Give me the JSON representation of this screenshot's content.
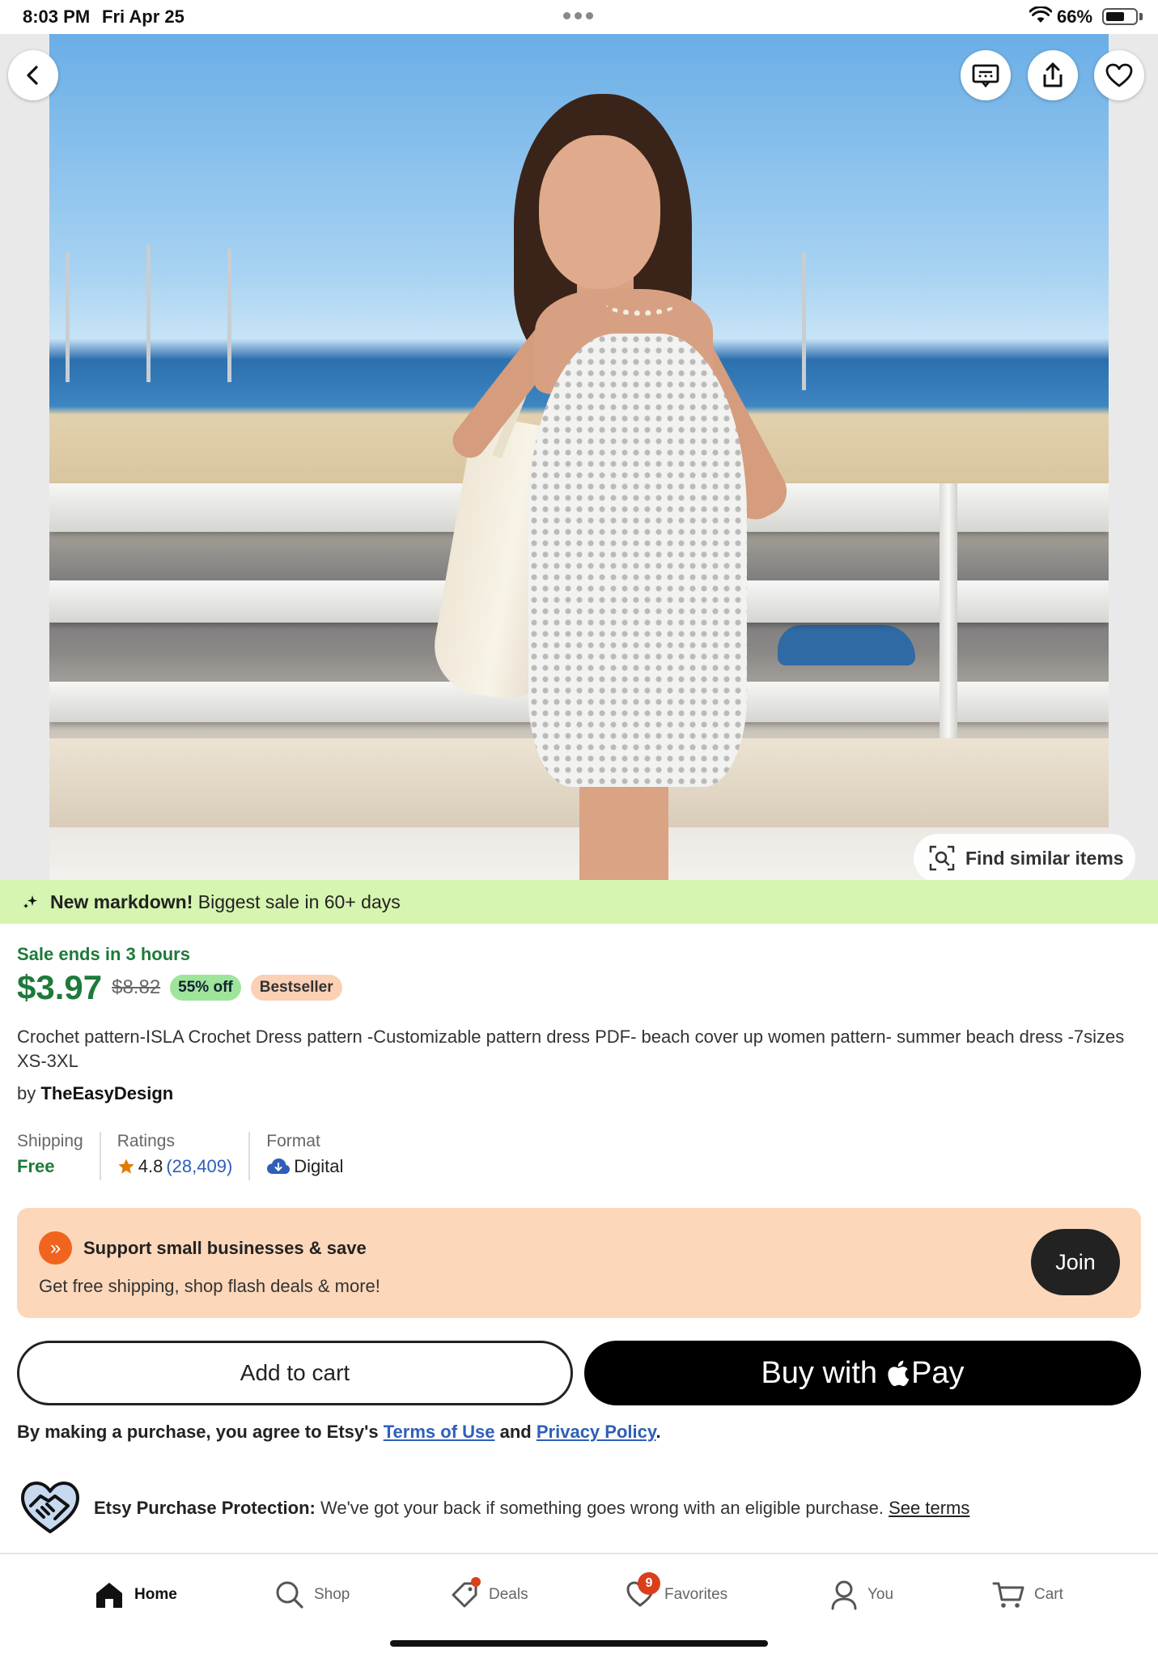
{
  "status_bar": {
    "time": "8:03 PM",
    "date": "Fri Apr 25",
    "battery": "66%",
    "battery_level": 0.66
  },
  "hero": {
    "find_similar_label": "Find similar items",
    "carousel_position": 0.08
  },
  "markdown_banner": {
    "bold": "New markdown!",
    "text": "Biggest sale in 60+ days"
  },
  "pricing": {
    "sale_ends": "Sale ends in 3 hours",
    "price": "$3.97",
    "original_price": "$8.82",
    "discount": "55% off",
    "badge": "Bestseller"
  },
  "listing": {
    "title": "Crochet pattern-ISLA Crochet Dress pattern -Customizable pattern dress PDF- beach cover up women pattern- summer beach dress -7sizes XS-3XL",
    "seller_prefix": "by",
    "seller_name": "TheEasyDesign"
  },
  "stats": {
    "shipping_label": "Shipping",
    "shipping_value": "Free",
    "ratings_label": "Ratings",
    "rating_value": "4.8",
    "rating_count": "(28,409)",
    "format_label": "Format",
    "format_value": "Digital"
  },
  "promo": {
    "title": "Support small businesses & save",
    "subtitle": "Get free shipping, shop flash deals & more!",
    "join_label": "Join"
  },
  "actions": {
    "add_to_cart": "Add to cart",
    "buy_with": "Buy with",
    "pay": "Pay"
  },
  "terms": {
    "prefix": "By making a purchase, you agree to Etsy's",
    "terms_link": "Terms of Use",
    "and": "and",
    "privacy_link": "Privacy Policy",
    "suffix": "."
  },
  "protection": {
    "bold": "Etsy Purchase Protection:",
    "text": "We've got your back if something goes wrong with an eligible purchase.",
    "link": "See terms"
  },
  "tabbar": {
    "items": [
      {
        "label": "Home",
        "icon": "home-icon"
      },
      {
        "label": "Shop",
        "icon": "search-icon"
      },
      {
        "label": "Deals",
        "icon": "tag-icon"
      },
      {
        "label": "Favorites",
        "icon": "heart-icon"
      },
      {
        "label": "You",
        "icon": "person-icon"
      },
      {
        "label": "Cart",
        "icon": "cart-icon"
      }
    ],
    "favorites_badge": "9"
  },
  "colors": {
    "sale_green": "#1f7a3a",
    "banner_green": "#d6f5b0",
    "promo_peach": "#fcd7ba",
    "etsy_orange": "#f1641e",
    "link_blue": "#2d5fb8"
  }
}
